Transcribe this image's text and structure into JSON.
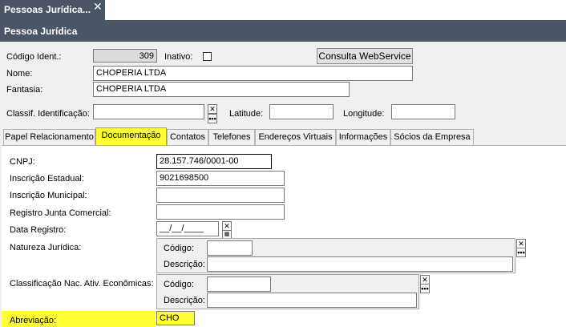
{
  "window": {
    "tab_title": "Pessoas Jurídica...",
    "close_glyph": "✕",
    "header": "Pessoa Jurídica"
  },
  "form": {
    "codigo_label": "Código Ident.:",
    "codigo_value": "309",
    "inativo_label": "Inativo:",
    "webservice_button": "Consulta WebService",
    "nome_label": "Nome:",
    "nome_value": "CHOPERIA LTDA",
    "fantasia_label": "Fantasia:",
    "fantasia_value": "CHOPERIA LTDA",
    "classif_label": "Classif. Identificação:",
    "latitude_label": "Latitude:",
    "longitude_label": "Longitude:"
  },
  "tabs": [
    {
      "label": "Papel Relacionamento"
    },
    {
      "label": "Documentação"
    },
    {
      "label": "Contatos"
    },
    {
      "label": "Telefones"
    },
    {
      "label": "Endereços Virtuais"
    },
    {
      "label": "Informações"
    },
    {
      "label": "Sócios da Empresa"
    }
  ],
  "documentacao": {
    "cnpj_label": "CNPJ:",
    "cnpj_value": "28.157.746/0001-00",
    "ie_label": "Inscrição Estadual:",
    "ie_value": "9021698500",
    "im_label": "Inscrição Municipal:",
    "rjc_label": "Registro Junta Comercial:",
    "data_label": "Data Registro:",
    "data_value": "__/__/____",
    "natureza_label": "Natureza Jurídica:",
    "classif_nac_label": "Classificação Nac. Ativ. Econômicas:",
    "codigo_sub": "Código:",
    "descricao_sub": "Descrição:",
    "abreviacao_label": "Abreviação:",
    "abreviacao_value": "CHO"
  },
  "icons": {
    "lookup_x": "✕",
    "lookup_dots": "•••"
  }
}
